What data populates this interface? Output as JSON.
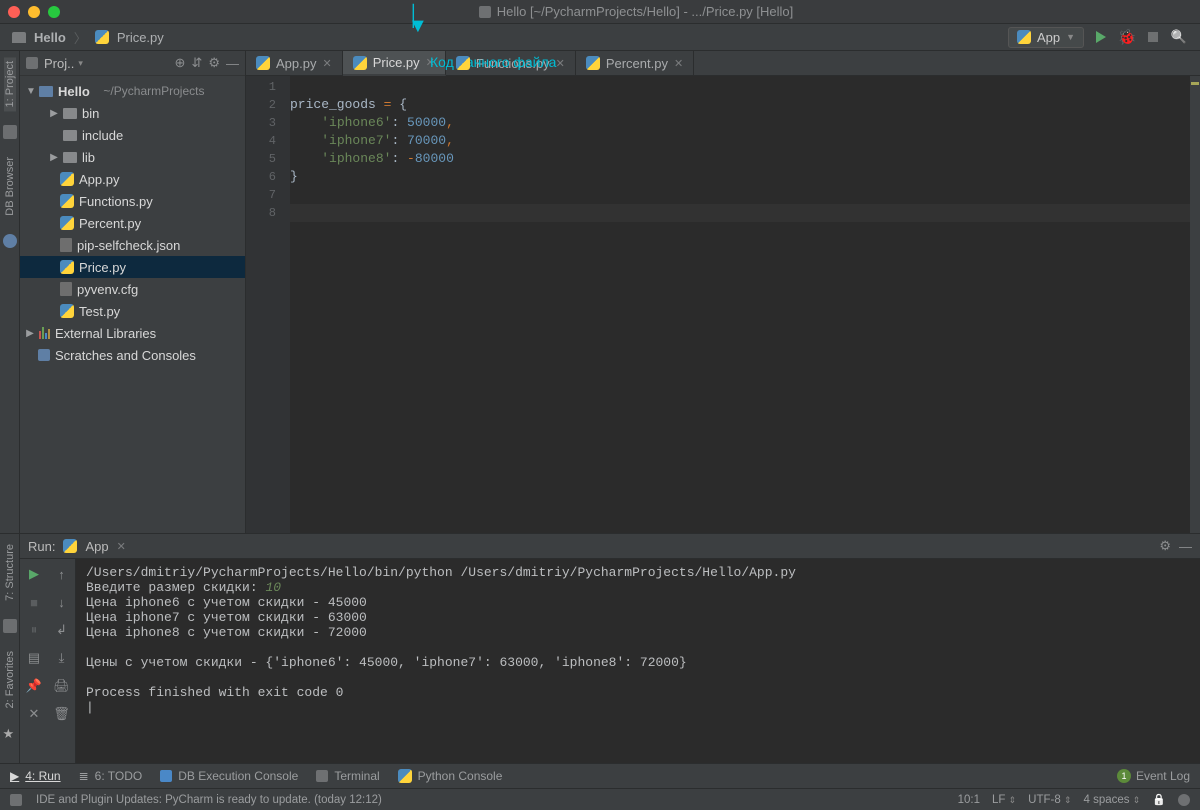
{
  "titlebar": {
    "title": "Hello [~/PycharmProjects/Hello] - .../Price.py [Hello]"
  },
  "callout": "Код данного файла",
  "breadcrumb": {
    "root": "Hello",
    "file": "Price.py"
  },
  "run_config": {
    "selected": "App"
  },
  "left_strip": {
    "project": "1: Project",
    "db_browser": "DB Browser"
  },
  "project_panel": {
    "header": "Proj..",
    "root_name": "Hello",
    "root_path": "~/PycharmProjects",
    "items": [
      {
        "label": "bin",
        "type": "folder",
        "indent": 1,
        "expand": "▶"
      },
      {
        "label": "include",
        "type": "folder",
        "indent": 1,
        "expand": ""
      },
      {
        "label": "lib",
        "type": "folder",
        "indent": 1,
        "expand": "▶"
      },
      {
        "label": "App.py",
        "type": "py",
        "indent": 1
      },
      {
        "label": "Functions.py",
        "type": "py",
        "indent": 1
      },
      {
        "label": "Percent.py",
        "type": "py",
        "indent": 1
      },
      {
        "label": "pip-selfcheck.json",
        "type": "file",
        "indent": 1
      },
      {
        "label": "Price.py",
        "type": "py",
        "indent": 1,
        "selected": true
      },
      {
        "label": "pyvenv.cfg",
        "type": "file",
        "indent": 1
      },
      {
        "label": "Test.py",
        "type": "py",
        "indent": 1
      }
    ],
    "external": "External Libraries",
    "scratches": "Scratches and Consoles"
  },
  "tabs": [
    {
      "label": "App.py",
      "active": false
    },
    {
      "label": "Price.py",
      "active": true
    },
    {
      "label": "Functions.py",
      "active": false
    },
    {
      "label": "Percent.py",
      "active": false
    }
  ],
  "code": {
    "lines": [
      "1",
      "2",
      "3",
      "4",
      "5",
      "6",
      "7",
      "8"
    ],
    "l2_a": "price_goods ",
    "l2_b": "=",
    "l2_c": " {",
    "l3_key": "'iphone6'",
    "l3_col": ": ",
    "l3_val": "50000",
    "l3_com": ",",
    "l4_key": "'iphone7'",
    "l4_val": "70000",
    "l5_key": "'iphone8'",
    "l5_neg": "-",
    "l5_val": "80000",
    "l6": "}"
  },
  "run": {
    "title": "Run:",
    "config": "App",
    "console_lines": [
      "/Users/dmitriy/PycharmProjects/Hello/bin/python /Users/dmitriy/PycharmProjects/Hello/App.py",
      "Введите размер скидки: ",
      "Цена iphone6 с учетом скидки - 45000",
      "Цена iphone7 с учетом скидки - 63000",
      "Цена iphone8 с учетом скидки - 72000",
      "",
      "Цены с учетом скидки - {'iphone6': 45000, 'iphone7': 63000, 'iphone8': 72000}",
      "",
      "Process finished with exit code 0",
      ""
    ],
    "input_value": "10"
  },
  "right_strip": {
    "structure": "7: Structure",
    "favorites": "2: Favorites"
  },
  "bottom_tabs": {
    "run": "4: Run",
    "todo": "6: TODO",
    "db": "DB Execution Console",
    "terminal": "Terminal",
    "pyconsole": "Python Console",
    "event_log": "Event Log"
  },
  "status": {
    "msg": "IDE and Plugin Updates: PyCharm is ready to update. (today 12:12)",
    "pos": "10:1",
    "le": "LF",
    "enc": "UTF-8",
    "indent": "4 spaces"
  }
}
